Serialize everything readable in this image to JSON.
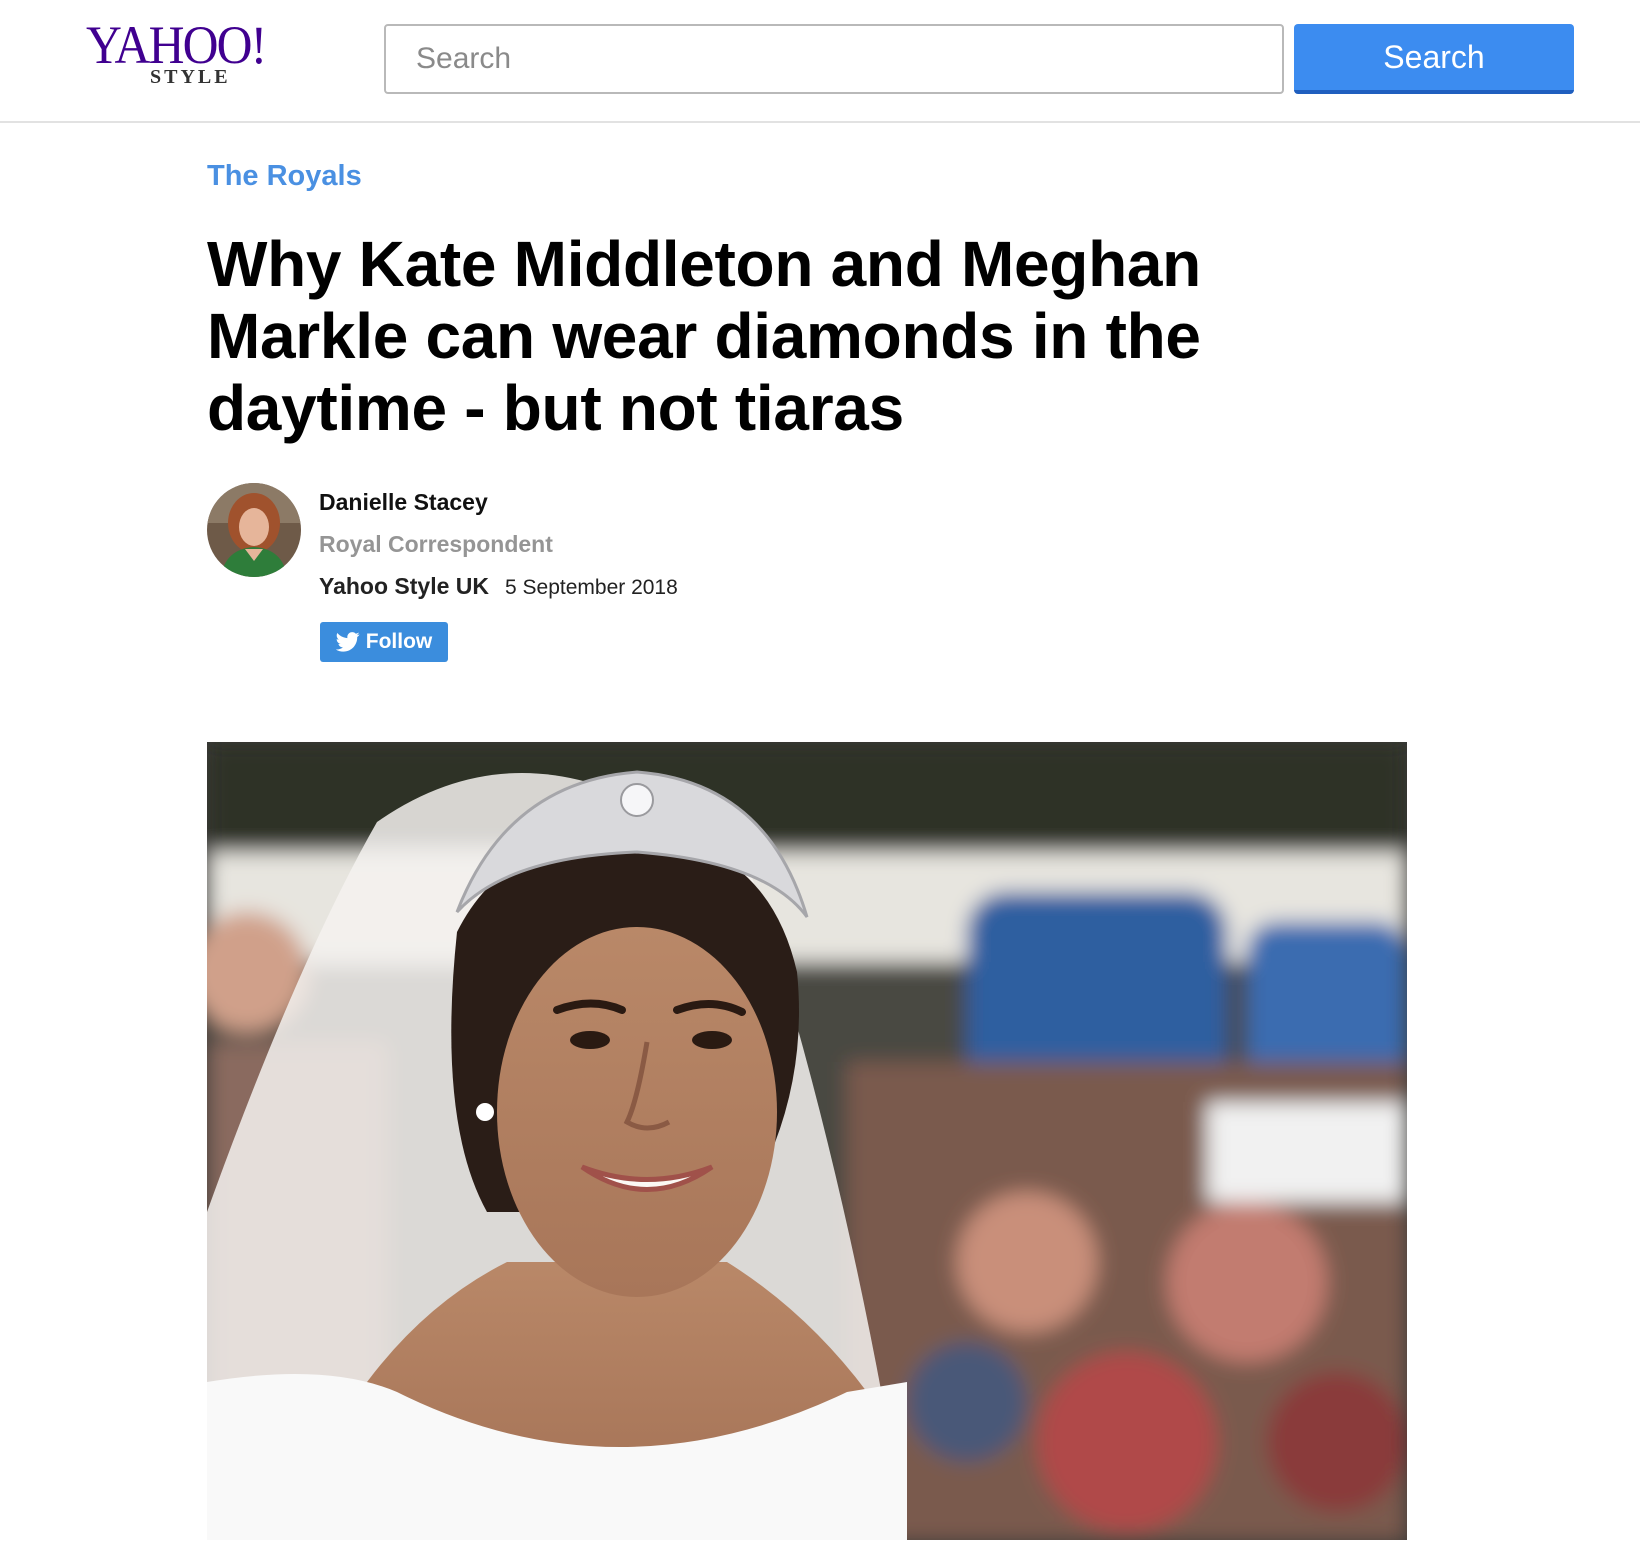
{
  "header": {
    "logo_main": "YAHOO!",
    "logo_sub": "STYLE",
    "search_placeholder": "Search",
    "search_button_label": "Search"
  },
  "article": {
    "category": "The Royals",
    "headline": "Why Kate Middleton and Meghan Markle can wear diamonds in the daytime - but not tiaras",
    "author": {
      "name": "Danielle Stacey",
      "title": "Royal Correspondent"
    },
    "provider": "Yahoo Style UK",
    "date": "5 September 2018",
    "follow_label": "Follow"
  },
  "icons": {
    "twitter": "twitter-bird-icon"
  },
  "colors": {
    "brand_purple": "#400090",
    "accent_blue": "#3c8cf0",
    "category_blue": "#4a90e2",
    "follow_blue": "#3b8ddd"
  }
}
